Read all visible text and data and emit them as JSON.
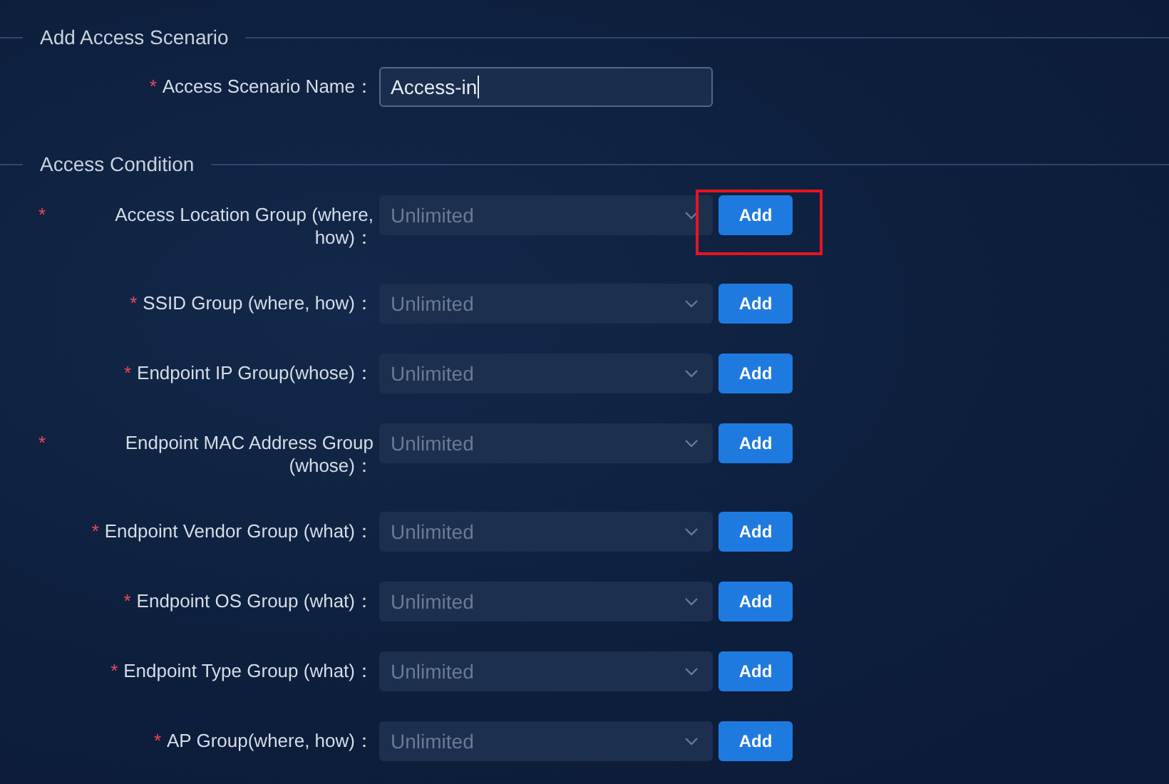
{
  "sections": [
    {
      "title": "Add Access Scenario",
      "fields": [
        {
          "kind": "input",
          "label": "Access Scenario Name：",
          "required_mark": "*",
          "value": "Access-in",
          "focused": true
        }
      ]
    },
    {
      "title": "Access Condition",
      "fields": [
        {
          "kind": "select",
          "label": "Access Location Group (where, how)：",
          "required_mark": "*",
          "value": "Unlimited",
          "button": "Add",
          "highlighted": true
        },
        {
          "kind": "select",
          "label": "SSID Group (where, how)：",
          "required_mark": "*",
          "value": "Unlimited",
          "button": "Add",
          "highlighted": false
        },
        {
          "kind": "select",
          "label": "Endpoint IP Group(whose)：",
          "required_mark": "*",
          "value": "Unlimited",
          "button": "Add",
          "highlighted": false
        },
        {
          "kind": "select",
          "label": "Endpoint MAC Address Group (whose)：",
          "required_mark": "*",
          "value": "Unlimited",
          "button": "Add",
          "highlighted": false
        },
        {
          "kind": "select",
          "label": "Endpoint Vendor Group (what)：",
          "required_mark": "*",
          "value": "Unlimited",
          "button": "Add",
          "highlighted": false
        },
        {
          "kind": "select",
          "label": "Endpoint OS Group (what)：",
          "required_mark": "*",
          "value": "Unlimited",
          "button": "Add",
          "highlighted": false
        },
        {
          "kind": "select",
          "label": "Endpoint Type Group (what)：",
          "required_mark": "*",
          "value": "Unlimited",
          "button": "Add",
          "highlighted": false
        },
        {
          "kind": "select",
          "label": "AP Group(where, how)：",
          "required_mark": "*",
          "value": "Unlimited",
          "button": "Add",
          "highlighted": false
        }
      ]
    }
  ]
}
